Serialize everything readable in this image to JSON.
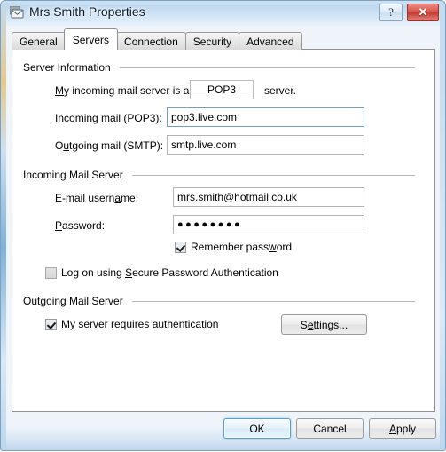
{
  "window": {
    "title": "Mrs Smith Properties",
    "icon": "mail-account-icon",
    "help_button_label": "?",
    "close_button_label": "✕",
    "accent_close": "#c0392b",
    "accent_default_button": "#4f9fd0"
  },
  "tabs": [
    {
      "label": "General",
      "active": false
    },
    {
      "label": "Servers",
      "active": true
    },
    {
      "label": "Connection",
      "active": false
    },
    {
      "label": "Security",
      "active": false
    },
    {
      "label": "Advanced",
      "active": false
    }
  ],
  "groups": {
    "server_information": {
      "title": "Server Information",
      "server_type_prefix_a": "M",
      "server_type_prefix_b": "y incoming mail server is a",
      "server_type_value": "POP3",
      "server_type_suffix": "server.",
      "incoming_label_a": "I",
      "incoming_label_b": "ncoming mail (POP3):",
      "incoming_value": "pop3.live.com",
      "outgoing_label_a": "O",
      "outgoing_label_b": "u",
      "outgoing_label_c": "tgoing mail (SMTP):",
      "outgoing_value": "smtp.live.com"
    },
    "incoming_mail_server": {
      "title": "Incoming Mail Server",
      "username_label_a": "E-mail usern",
      "username_label_b": "a",
      "username_label_c": "me:",
      "username_value": "mrs.smith@hotmail.co.uk",
      "password_label_a": "P",
      "password_label_b": "assword:",
      "password_value": "●●●●●●●●",
      "remember_password_a": "Remember pass",
      "remember_password_b": "w",
      "remember_password_c": "ord",
      "remember_password_checked": true,
      "spa_label_a": "Log on using ",
      "spa_label_b": "S",
      "spa_label_c": "ecure Password Authentication",
      "spa_checked": false
    },
    "outgoing_mail_server": {
      "title": "Outgoing Mail Server",
      "requires_auth_a": "My ser",
      "requires_auth_b": "v",
      "requires_auth_c": "er requires authentication",
      "requires_auth_checked": true,
      "settings_button_a": "S",
      "settings_button_b": "e",
      "settings_button_c": "ttings..."
    }
  },
  "footer": {
    "ok_label": "OK",
    "cancel_label": "Cancel",
    "apply_label_a": "A",
    "apply_label_b": "pply"
  }
}
